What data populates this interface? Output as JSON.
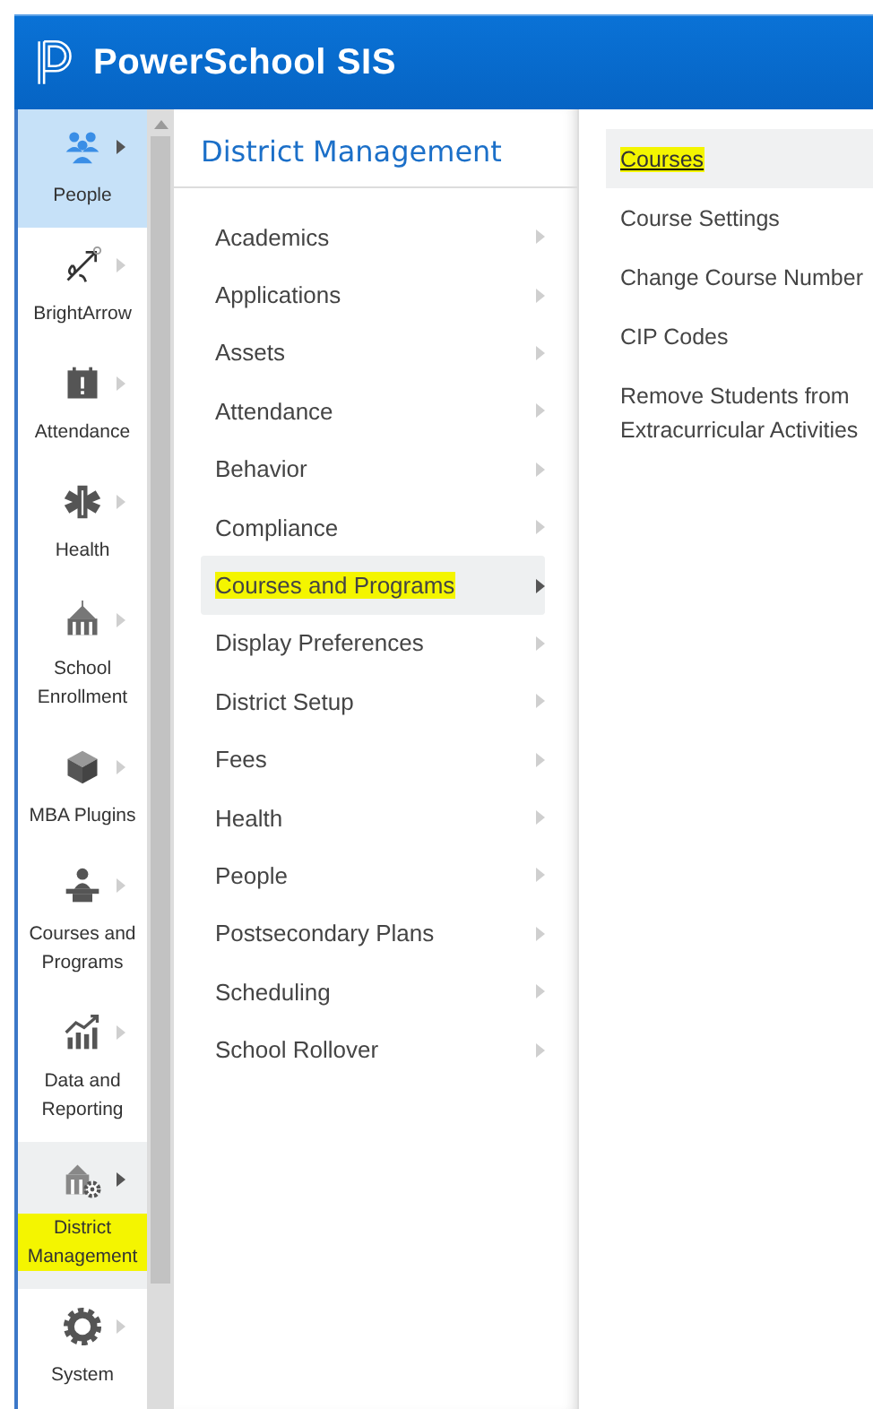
{
  "header": {
    "title": "PowerSchool SIS"
  },
  "nav": {
    "items": [
      {
        "label": "People",
        "kind": "people",
        "selected": true,
        "highlighted": false
      },
      {
        "label": "BrightArrow",
        "kind": "arrow",
        "selected": false,
        "highlighted": false
      },
      {
        "label": "Attendance",
        "kind": "calendar",
        "selected": false,
        "highlighted": false
      },
      {
        "label": "Health",
        "kind": "medical",
        "selected": false,
        "highlighted": false
      },
      {
        "label": "School Enrollment",
        "kind": "school",
        "selected": false,
        "highlighted": false
      },
      {
        "label": "MBA Plugins",
        "kind": "cube",
        "selected": false,
        "highlighted": false
      },
      {
        "label": "Courses and Programs",
        "kind": "podium",
        "selected": false,
        "highlighted": false
      },
      {
        "label": "Data and Reporting",
        "kind": "chart",
        "selected": false,
        "highlighted": false
      },
      {
        "label": "District Management",
        "kind": "building",
        "selected": true,
        "highlighted": true
      },
      {
        "label": "System",
        "kind": "gear",
        "selected": false,
        "highlighted": false
      }
    ]
  },
  "menu": {
    "title": "District Management",
    "items": [
      {
        "label": "Academics",
        "selected": false,
        "highlighted": false
      },
      {
        "label": "Applications",
        "selected": false,
        "highlighted": false
      },
      {
        "label": "Assets",
        "selected": false,
        "highlighted": false
      },
      {
        "label": "Attendance",
        "selected": false,
        "highlighted": false
      },
      {
        "label": "Behavior",
        "selected": false,
        "highlighted": false
      },
      {
        "label": "Compliance",
        "selected": false,
        "highlighted": false
      },
      {
        "label": "Courses and Programs",
        "selected": true,
        "highlighted": true
      },
      {
        "label": "Display Preferences",
        "selected": false,
        "highlighted": false
      },
      {
        "label": "District Setup",
        "selected": false,
        "highlighted": false
      },
      {
        "label": "Fees",
        "selected": false,
        "highlighted": false
      },
      {
        "label": "Health",
        "selected": false,
        "highlighted": false
      },
      {
        "label": "People",
        "selected": false,
        "highlighted": false
      },
      {
        "label": "Postsecondary Plans",
        "selected": false,
        "highlighted": false
      },
      {
        "label": "Scheduling",
        "selected": false,
        "highlighted": false
      },
      {
        "label": "School Rollover",
        "selected": false,
        "highlighted": false
      }
    ]
  },
  "submenu": {
    "items": [
      {
        "label": "Courses",
        "selected": true,
        "highlighted": true
      },
      {
        "label": "Course Settings",
        "selected": false,
        "highlighted": false
      },
      {
        "label": "Change Course Number",
        "selected": false,
        "highlighted": false
      },
      {
        "label": "CIP Codes",
        "selected": false,
        "highlighted": false
      },
      {
        "label": "Remove Students from Extracurricular Activities",
        "selected": false,
        "highlighted": false
      }
    ]
  }
}
